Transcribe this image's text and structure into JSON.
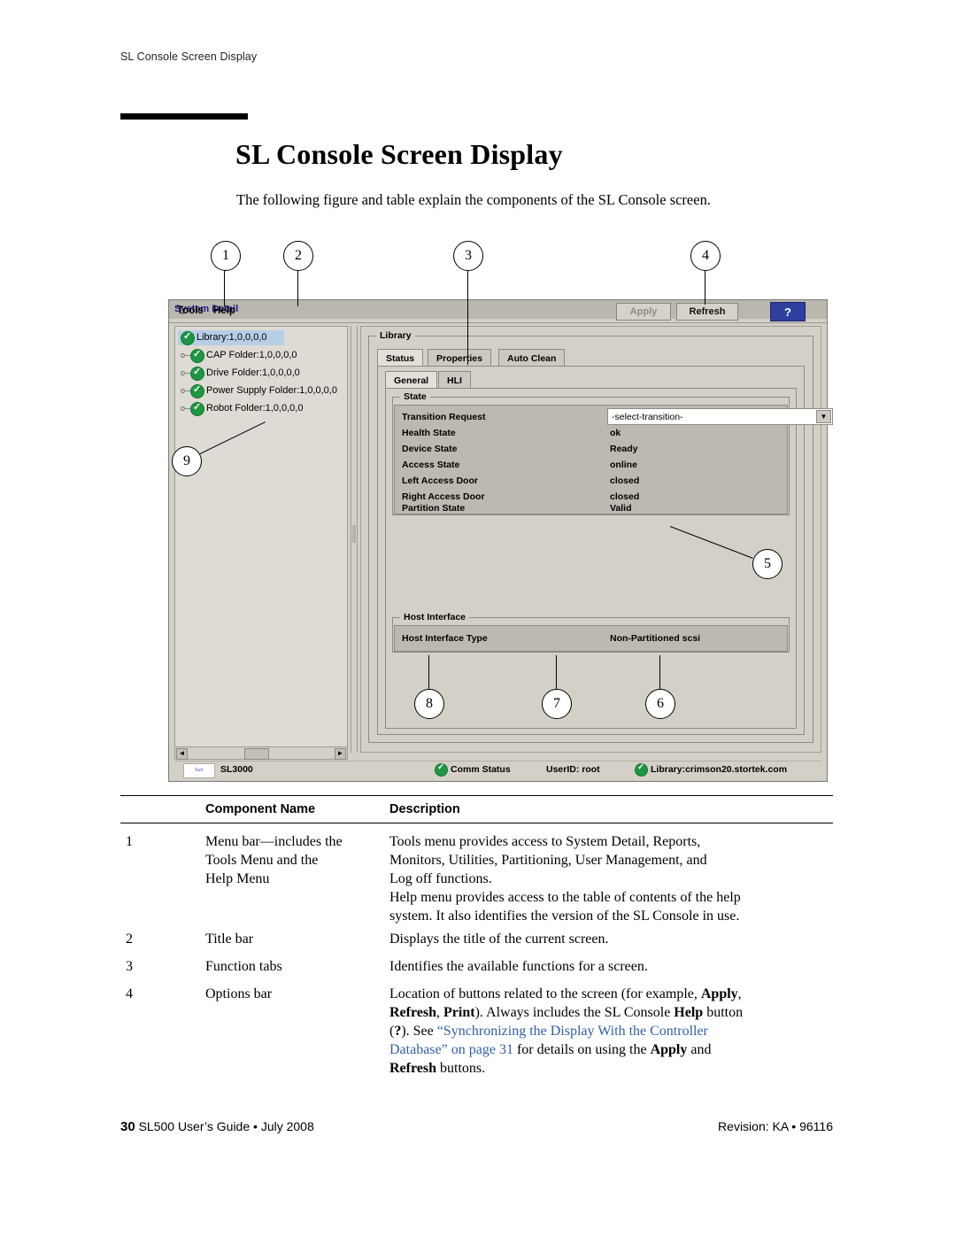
{
  "running_head": "SL Console Screen Display",
  "title": "SL Console Screen Display",
  "intro": "The following figure and table explain the components of the SL Console screen.",
  "callouts": [
    "1",
    "2",
    "3",
    "4",
    "5",
    "6",
    "7",
    "8",
    "9"
  ],
  "screenshot": {
    "menubar": {
      "tools": "Tools",
      "help": "Help",
      "system_detail": "System Detail"
    },
    "options_bar": {
      "apply": "Apply",
      "refresh": "Refresh",
      "help": "?"
    },
    "tree": [
      {
        "label": "Library:1,0,0,0,0",
        "selected": true
      },
      {
        "label": "CAP Folder:1,0,0,0,0",
        "selected": false
      },
      {
        "label": "Drive Folder:1,0,0,0,0",
        "selected": false
      },
      {
        "label": "Power Supply Folder:1,0,0,0,0",
        "selected": false
      },
      {
        "label": "Robot Folder:1,0,0,0,0",
        "selected": false
      }
    ],
    "panel_title": "Library",
    "tabs_row1": [
      "Status",
      "Properties",
      "Auto Clean"
    ],
    "tabs_row2": [
      "General",
      "HLI"
    ],
    "state_group": "State",
    "state_rows": [
      {
        "label": "Transition Request",
        "value": "-select-transition-",
        "type": "combo"
      },
      {
        "label": "Health State",
        "value": "ok",
        "type": "text"
      },
      {
        "label": "Device State",
        "value": "Ready",
        "type": "text"
      },
      {
        "label": "Access State",
        "value": "online",
        "type": "text"
      },
      {
        "label": "Left Access Door",
        "value": "closed",
        "type": "text"
      },
      {
        "label": "Right Access Door",
        "value": "closed",
        "type": "text"
      },
      {
        "label": "Partition State",
        "value": "Valid",
        "type": "text"
      }
    ],
    "host_group": "Host Interface",
    "host_rows": [
      {
        "label": "Host Interface Type",
        "value": "Non-Partitioned scsi"
      }
    ],
    "statusbar": {
      "logo": "Sun",
      "device": "SL3000",
      "comm_status": "Comm Status",
      "userid": "UserID: root",
      "library": "Library:crimson20.stortek.com"
    }
  },
  "table": {
    "headers": {
      "name": "Component Name",
      "description": "Description"
    },
    "rows": [
      {
        "num": "1",
        "name_lines": [
          "Menu bar—includes the",
          "Tools Menu and the",
          "Help Menu"
        ],
        "desc_lines": [
          "Tools menu provides access to System Detail, Reports,",
          "Monitors, Utilities, Partitioning, User Management, and",
          "Log off functions.",
          "Help menu provides access to the table of contents of the help",
          "system. It also identifies the version of the SL Console in use."
        ]
      },
      {
        "num": "2",
        "name_lines": [
          "Title bar"
        ],
        "desc_lines": [
          "Displays the title of the current screen."
        ]
      },
      {
        "num": "3",
        "name_lines": [
          "Function tabs"
        ],
        "desc_lines": [
          "Identifies the available functions for a screen."
        ]
      },
      {
        "num": "4",
        "name_lines": [
          "Options bar"
        ],
        "desc_lines": []
      }
    ],
    "row4_rich": {
      "l1_a": "Location of buttons related to the screen (for example, ",
      "l1_b": "Apply",
      "l1_c": ",",
      "l2_a": "Refresh",
      "l2_b": ", ",
      "l2_c": "Print",
      "l2_d": "). Always includes the SL Console ",
      "l2_e": "Help",
      "l2_f": " button",
      "l3_a": "(",
      "l3_b": "?",
      "l3_c": "). See ",
      "l3_d": "“Synchronizing the Display With the Controller",
      "l4_a": "Database” on page 31",
      "l4_b": " for details on using the ",
      "l4_c": "Apply",
      "l4_d": " and",
      "l5_a": "Refresh",
      "l5_b": " buttons."
    }
  },
  "footer": {
    "page": "30",
    "left": "SL500 User’s Guide • July 2008",
    "right": "Revision: KA • 96116"
  }
}
